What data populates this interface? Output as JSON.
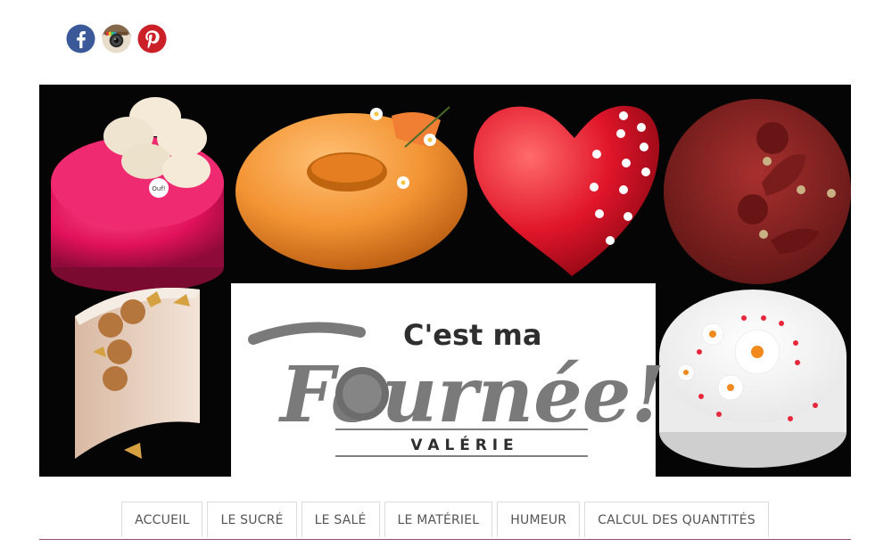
{
  "social": [
    {
      "network": "facebook",
      "icon": "facebook-icon",
      "color": "#3b5998"
    },
    {
      "network": "instagram",
      "icon": "instagram-icon",
      "color": "#7a5a3e"
    },
    {
      "network": "pinterest",
      "icon": "pinterest-icon",
      "color": "#cb2027"
    }
  ],
  "logo": {
    "tagline": "C'est ma",
    "name": "Fournée!",
    "author": "V A L É R I E",
    "badge_text": "Ouf!"
  },
  "colors": {
    "nav_border": "#9b4b7a",
    "nav_text": "#555555",
    "logo_gray": "#7a7a7a"
  },
  "nav": {
    "items": [
      {
        "label": "ACCUEIL"
      },
      {
        "label": "LE SUCRÉ"
      },
      {
        "label": "LE SALÉ"
      },
      {
        "label": "LE MATÉRIEL"
      },
      {
        "label": "HUMEUR"
      },
      {
        "label": "CALCUL DES QUANTITÉS"
      }
    ]
  }
}
